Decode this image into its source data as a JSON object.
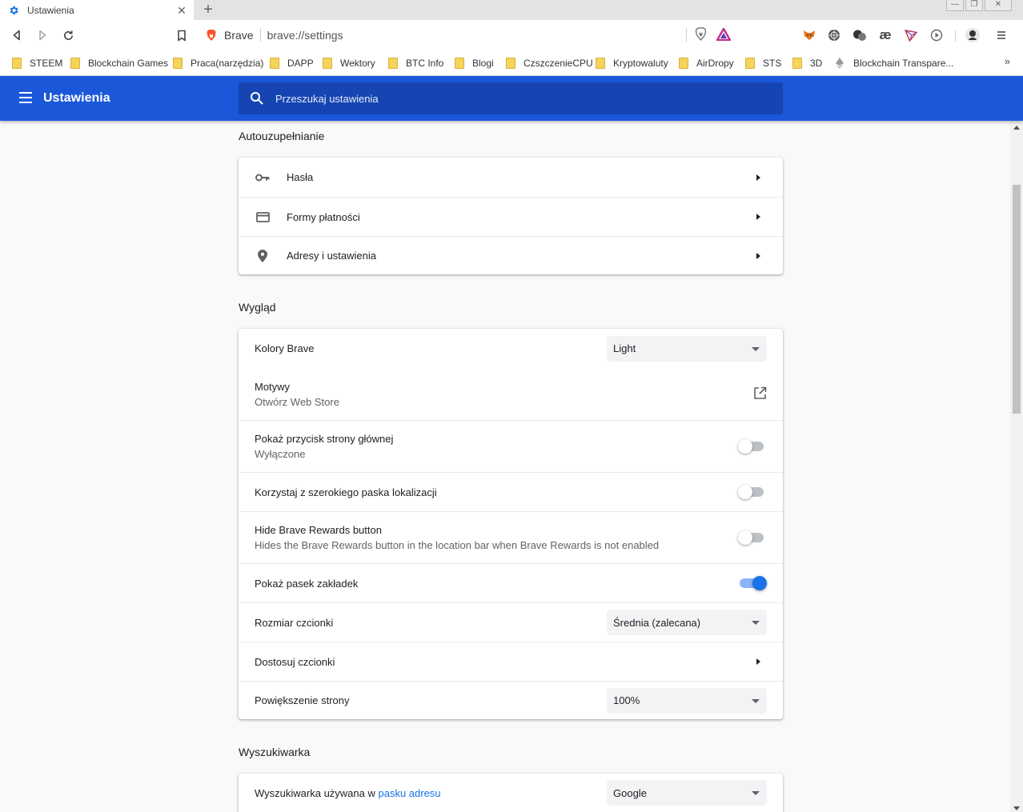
{
  "tab": {
    "title": "Ustawienia"
  },
  "window_controls": {
    "minimize": "—",
    "restore": "❐",
    "close": "✕"
  },
  "omnibox": {
    "site_chip": "Brave",
    "url": "brave://settings"
  },
  "extensions": [
    "fox-icon",
    "globe-icon",
    "coins-icon",
    "ae-icon",
    "tron-icon",
    "play-icon",
    "profile-avatar"
  ],
  "extension_glyphs": {
    "ae": "æ"
  },
  "bookmarks": [
    "STEEM",
    "Blockchain Games",
    "Praca(narzędzia)",
    "DAPP",
    "Wektory",
    "BTC Info",
    "Blogi",
    "CzszczenieCPU",
    "Kryptowaluty",
    "AirDropy",
    "STS",
    "3D",
    "Blockchain Transpare..."
  ],
  "bookmarks_more": "»",
  "header": {
    "title": "Ustawienia",
    "search_placeholder": "Przeszukaj ustawienia"
  },
  "autofill": {
    "title": "Autouzupełnianie",
    "items": [
      {
        "label": "Hasła",
        "icon": "key-icon"
      },
      {
        "label": "Formy płatności",
        "icon": "credit-card-icon"
      },
      {
        "label": "Adresy i ustawienia",
        "icon": "location-pin-icon"
      }
    ]
  },
  "appearance": {
    "title": "Wygląd",
    "colors_label": "Kolory Brave",
    "colors_value": "Light",
    "themes_label": "Motywy",
    "themes_sub": "Otwórz Web Store",
    "home_label": "Pokaż przycisk strony głównej",
    "home_sub": "Wyłączone",
    "home_on": false,
    "wide_label": "Korzystaj z szerokiego paska lokalizacji",
    "wide_on": false,
    "rewards_label": "Hide Brave Rewards button",
    "rewards_sub": "Hides the Brave Rewards button in the location bar when Brave Rewards is not enabled",
    "rewards_on": false,
    "bookmarks_bar_label": "Pokaż pasek zakładek",
    "bookmarks_bar_on": true,
    "font_size_label": "Rozmiar czcionki",
    "font_size_value": "Średnia (zalecana)",
    "customize_fonts_label": "Dostosuj czcionki",
    "zoom_label": "Powiększenie strony",
    "zoom_value": "100%"
  },
  "search": {
    "title": "Wyszukiwarka",
    "engine_label_prefix": "Wyszukiwarka używana w ",
    "engine_label_link": "pasku adresu",
    "engine_value": "Google"
  },
  "colors": {
    "header_blue": "#1a58d9",
    "accent": "#1a73e8"
  }
}
